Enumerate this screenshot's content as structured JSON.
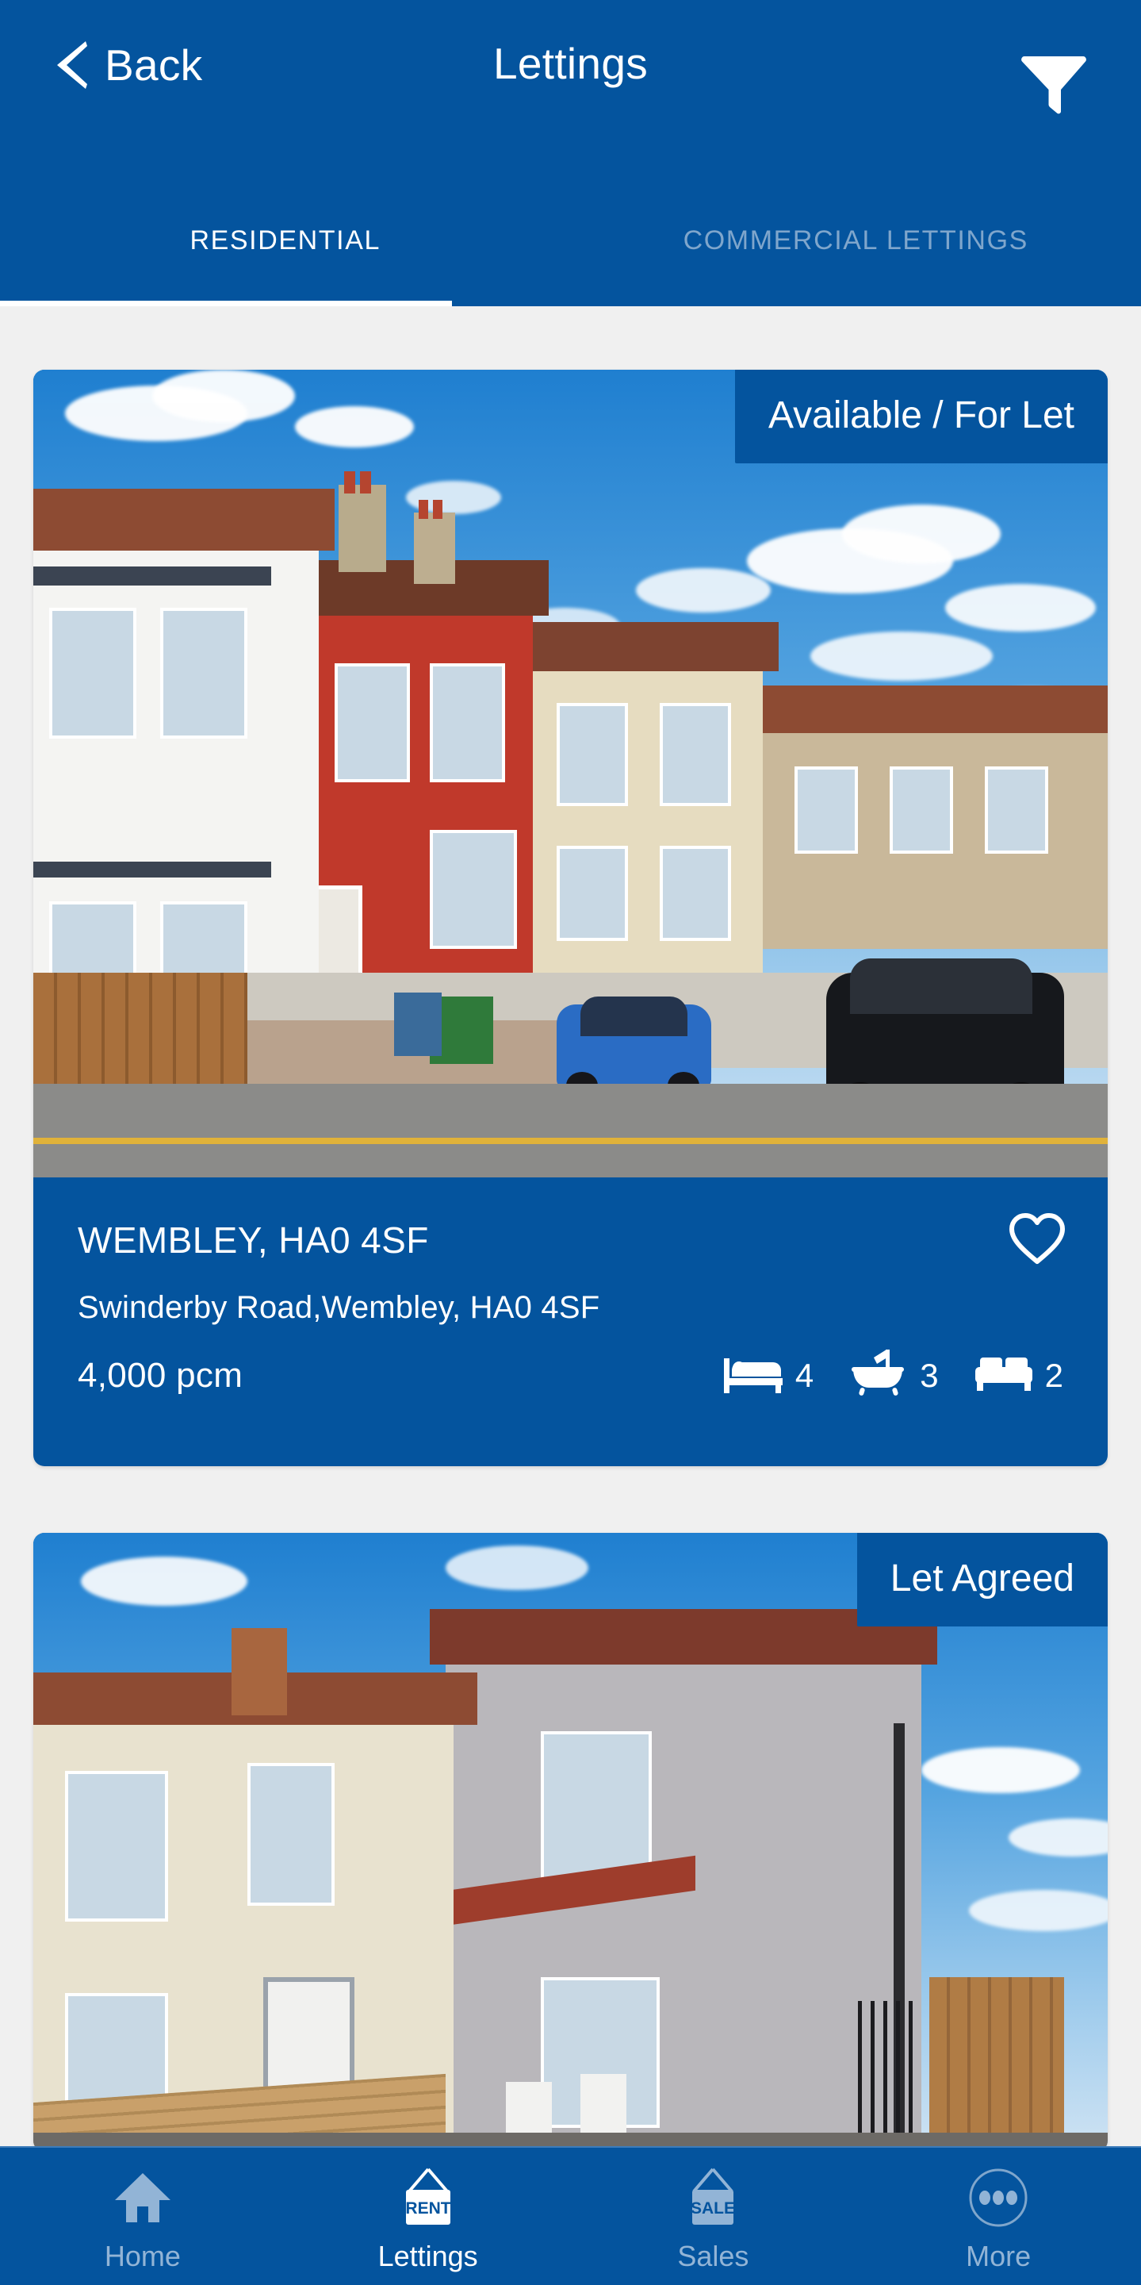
{
  "header": {
    "back_label": "Back",
    "title": "Lettings",
    "back_icon": "chevron-left-icon",
    "filter_icon": "filter-funnel-icon"
  },
  "tabs": [
    {
      "label": "RESIDENTIAL",
      "active": true
    },
    {
      "label": "COMMERCIAL LETTINGS",
      "active": false
    }
  ],
  "colors": {
    "brand_blue": "#04549E",
    "page_background": "#F0F0F0",
    "inactive_tab": "#7FA6CC",
    "inactive_nav": "#92B4D6"
  },
  "listings": [
    {
      "status_badge": "Available / For Let",
      "title": "WEMBLEY, HA0 4SF",
      "address": "Swinderby Road,Wembley, HA0 4SF",
      "price": "4,000 pcm",
      "favorite_icon": "heart-outline-icon",
      "features": [
        {
          "icon": "bed-icon",
          "count": "4"
        },
        {
          "icon": "bath-icon",
          "count": "3"
        },
        {
          "icon": "sofa-icon",
          "count": "2"
        }
      ]
    },
    {
      "status_badge": "Let Agreed"
    }
  ],
  "bottom_nav": [
    {
      "label": "Home",
      "icon": "home-icon",
      "active": false
    },
    {
      "label": "Lettings",
      "icon": "rent-sign-icon",
      "active": true
    },
    {
      "label": "Sales",
      "icon": "sale-sign-icon",
      "active": false
    },
    {
      "label": "More",
      "icon": "more-dots-icon",
      "active": false
    }
  ]
}
